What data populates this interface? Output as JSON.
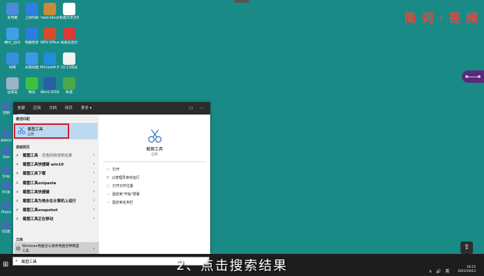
{
  "watermark": "简 词 · 视 频",
  "desktop": {
    "icons": [
      {
        "label": "此电脑",
        "color": "#4a8cd8"
      },
      {
        "label": "上网导航",
        "color": "#2f7fe0"
      },
      {
        "label": "read aloud",
        "color": "#c98a3a"
      },
      {
        "label": "新建文本文档",
        "color": "#ffffff"
      },
      {
        "label": "腾讯_迅IO",
        "color": "#3fa0e8"
      },
      {
        "label": "电脑管家",
        "color": "#2b7ee0"
      },
      {
        "label": "WPS Office",
        "color": "#d84a2e"
      },
      {
        "label": "网易云音乐",
        "color": "#d83a3a"
      },
      {
        "label": "网络",
        "color": "#3a8ee0"
      },
      {
        "label": "百度网盘",
        "color": "#3a9ae8"
      },
      {
        "label": "Microsoft Edge",
        "color": "#1f8fd8"
      },
      {
        "label": "10.13测试",
        "color": "#f2f2f2"
      },
      {
        "label": "回收站",
        "color": "#9ab3c9"
      },
      {
        "label": "微信",
        "color": "#3cc23c"
      },
      {
        "label": "Word 2016",
        "color": "#2b5ca8"
      },
      {
        "label": "新建",
        "color": "#4aa84a"
      }
    ],
    "left_edge_labels": [
      "控制",
      "Admin",
      "Goo",
      "Snip",
      "EV录",
      "Photo",
      "QQ影"
    ]
  },
  "start_menu": {
    "tabs": [
      "全部",
      "应用",
      "文档",
      "网页",
      "更多 ▾"
    ],
    "right_icons": [
      "person-icon",
      "ellipsis-icon"
    ],
    "best_match_title": "最佳匹配",
    "best_match": {
      "name": "截图工具",
      "type": "应用"
    },
    "web_search_title": "搜索网页",
    "web_results": [
      {
        "text": "截图工具",
        "sub": " - 查看网络搜索结果"
      },
      {
        "text": "截图工具快捷键 win10",
        "sub": ""
      },
      {
        "text": "截图工具下载",
        "sub": ""
      },
      {
        "text": "截图工具snipaste",
        "sub": ""
      },
      {
        "text": "截图工具快捷键",
        "sub": ""
      },
      {
        "text": "截图工具为啥永在计算机上运行",
        "sub": ""
      },
      {
        "text": "截图工具snapshot",
        "sub": ""
      },
      {
        "text": "截图工具正在移动",
        "sub": ""
      }
    ],
    "documents_title": "文档",
    "document": {
      "text": "Windows电脑怎么使用电脑自带截图工具"
    },
    "detail": {
      "name": "截图工具",
      "type": "应用",
      "actions": [
        "打开",
        "以管理员身份运行",
        "打开文件位置",
        "固定到\"开始\"屏幕",
        "固定到任务栏"
      ]
    }
  },
  "taskbar": {
    "search_value": "截图工具",
    "caption": "2、点击搜索结果",
    "time": "16:15",
    "date": "2021/10/13",
    "tray": "∧ 🔊 英"
  }
}
